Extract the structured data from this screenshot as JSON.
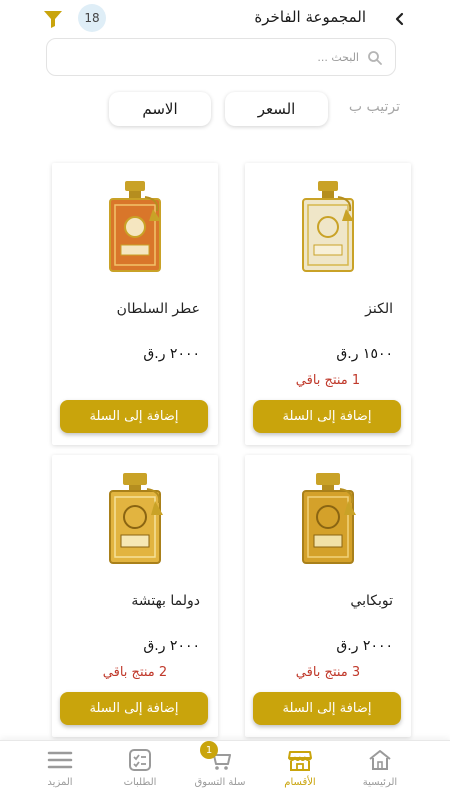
{
  "header": {
    "title": "المجموعة الفاخرة",
    "count": "18"
  },
  "search": {
    "placeholder": "البحث ..."
  },
  "sort": {
    "label": "ترتيب ب",
    "options": [
      "السعر",
      "الاسم"
    ]
  },
  "products": [
    {
      "name": "الكنز",
      "price": "١٥٠٠ ر.ق",
      "stock": "1 منتج باقي",
      "button": "إضافة إلى السلة",
      "bottle": "clear"
    },
    {
      "name": "عطر السلطان",
      "price": "٢٠٠٠ ر.ق",
      "stock": "",
      "button": "إضافة إلى السلة",
      "bottle": "orange"
    },
    {
      "name": "توبكابي",
      "price": "٢٠٠٠ ر.ق",
      "stock": "3 منتج باقي",
      "button": "إضافة إلى السلة",
      "bottle": "amber"
    },
    {
      "name": "دولما بهتشة",
      "price": "٢٠٠٠ ر.ق",
      "stock": "2 منتج باقي",
      "button": "إضافة إلى السلة",
      "bottle": "gold"
    }
  ],
  "nav": {
    "items": [
      {
        "label": "الرئيسية",
        "icon": "home-icon"
      },
      {
        "label": "الأقسام",
        "icon": "store-icon",
        "active": true
      },
      {
        "label": "سلة التسوق",
        "icon": "cart-icon",
        "badge": "1"
      },
      {
        "label": "الطلبات",
        "icon": "orders-icon"
      },
      {
        "label": "المزيد",
        "icon": "menu-icon"
      }
    ]
  },
  "colors": {
    "accent": "#c9a40c",
    "stock": "#c0392b",
    "badge_bg": "#dfeef7"
  }
}
